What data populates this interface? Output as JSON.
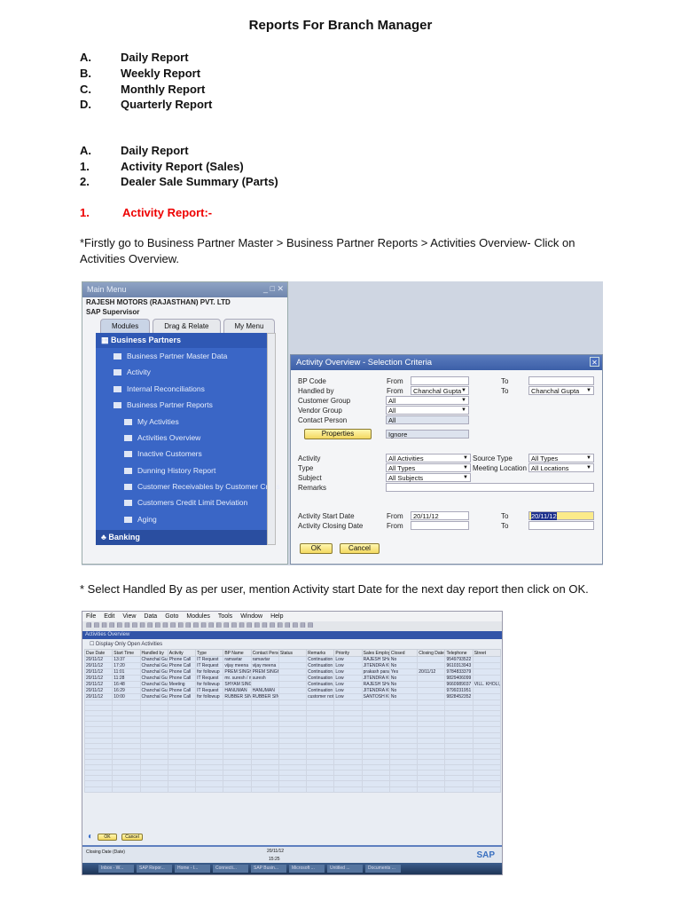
{
  "title": "Reports For Branch Manager",
  "overview": [
    {
      "letter": "A.",
      "label": "Daily Report"
    },
    {
      "letter": "B.",
      "label": "Weekly Report"
    },
    {
      "letter": "C.",
      "label": "Monthly Report"
    },
    {
      "letter": "D.",
      "label": "Quarterly Report"
    }
  ],
  "daily": {
    "letter": "A.",
    "label": "Daily Report",
    "items": [
      {
        "letter": "1.",
        "label": "Activity Report (Sales)"
      },
      {
        "letter": "2.",
        "label": "Dealer Sale Summary (Parts)"
      }
    ]
  },
  "section1": {
    "num": "1.",
    "title": "Activity Report:-"
  },
  "para1_line1": "*Firstly go to Business Partner Master > Business Partner Reports > Activities Overview- Click on",
  "para1_line2": "Activities Overview.",
  "para2": "* Select Handled By as per user, mention Activity start Date for the next day report then click on OK.",
  "main_menu": {
    "title": "Main Menu",
    "window_buttons": "_ □ ✕",
    "company": "RAJESH MOTORS (RAJASTHAN) PVT. LTD",
    "user": "SAP Supervisor",
    "tabs": [
      "Modules",
      "Drag & Relate",
      "My Menu"
    ],
    "module": "Business Partners",
    "items": [
      "Business Partner Master Data",
      "Activity",
      "Internal Reconciliations",
      "Business Partner Reports"
    ],
    "subitems": [
      "My Activities",
      "Activities Overview",
      "Inactive Customers",
      "Dunning History Report",
      "Customer Receivables by Customer Cross",
      "Customers Credit Limit Deviation",
      "Aging"
    ],
    "next_module": "Banking"
  },
  "dialog": {
    "title": "Activity Overview - Selection Criteria",
    "from": "From",
    "to": "To",
    "bp_code": "BP Code",
    "handled_by": "Handled by",
    "handled_from": "Chanchal Gupta",
    "handled_to": "Chanchal Gupta",
    "customer_group": "Customer Group",
    "customer_group_val": "All",
    "vendor_group": "Vendor Group",
    "vendor_group_val": "All",
    "contact_person": "Contact Person",
    "contact_person_val": "All",
    "properties": "Properties",
    "properties_val": "Ignore",
    "activity": "Activity",
    "activity_val": "All Activities",
    "source_type": "Source Type",
    "source_type_val": "All Types",
    "type": "Type",
    "type_val": "All Types",
    "meeting_location": "Meeting Location",
    "meeting_location_val": "All Locations",
    "subject": "Subject",
    "subject_val": "All Subjects",
    "remarks": "Remarks",
    "start_date": "Activity Start Date",
    "start_from": "20/11/12",
    "start_to": "20/11/12",
    "closing_date": "Activity Closing Date",
    "ok": "OK",
    "cancel": "Cancel"
  },
  "sap": {
    "menu": [
      "File",
      "Edit",
      "View",
      "Data",
      "Goto",
      "Modules",
      "Tools",
      "Window",
      "Help"
    ],
    "window_title": "Activities Overview",
    "checkbox": "Display Only Open Activities",
    "columns": [
      "Due Date",
      "Start Time",
      "Handled by",
      "Activity",
      "Type",
      "BP Name",
      "Contact Person",
      "Status",
      "Remarks",
      "Priority",
      "Sales Employee",
      "Closed",
      "Closing Date",
      "Telephone",
      "Street"
    ],
    "rows": [
      [
        "20/11/12",
        "13:37",
        "Chanchal Gupta",
        "Phone Call",
        "IT Request",
        "ramavtar",
        "ramavtar",
        "",
        "Continuation",
        "Low",
        "RAJESH SHARMA",
        "No",
        "",
        "9549793522",
        ""
      ],
      [
        "20/11/12",
        "17:20",
        "Chanchal Gupta",
        "Phone Call",
        "IT Request",
        "vijay meena",
        "vijay meena",
        "",
        "Continuation",
        "Low",
        "JITENDRA KUMAR GUPTA",
        "No",
        "",
        "9610313943",
        ""
      ],
      [
        "20/11/12",
        "11:01",
        "Chanchal Gupta",
        "Phone Call",
        "for followup",
        "PREM SINGH",
        "PREM SINGH",
        "",
        "Continuation, purchased",
        "Low",
        "prakash parashar",
        "Yes",
        "20/11/12",
        "9784833379",
        ""
      ],
      [
        "20/11/12",
        "11:28",
        "Chanchal Gupta",
        "Phone Call",
        "IT Request",
        "mr. suresh / mr. jitendra",
        "suresh",
        "",
        "Continuation",
        "Low",
        "JITENDRA KUMAR GUPTA",
        "No",
        "",
        "9829406099",
        ""
      ],
      [
        "20/11/12",
        "16:48",
        "Chanchal Gupta",
        "Meeting",
        "for followup",
        "SHYAM SINGH",
        "",
        "",
        "Continuation, # # NEC",
        "Low",
        "RAJESH SHARMA",
        "No",
        "",
        "9660989037",
        "VILL. KHOLI, KHATIPURA, TEHSIL - BAS"
      ],
      [
        "20/11/12",
        "16:29",
        "Chanchal Gupta",
        "Phone Call",
        "IT Request",
        "HANUMAN",
        "HANUMAN",
        "",
        "Continuation",
        "Low",
        "JITENDRA KUMAR GUPTA",
        "No",
        "",
        "9799231951",
        ""
      ],
      [
        "20/11/12",
        "10:00",
        "Chanchal Gupta",
        "Phone Call",
        "for followup",
        "RUBBER SINGH",
        "RUBBER SINGH",
        "",
        "customer not purchased",
        "Low",
        "SANTOSH KHANDELWAL",
        "No",
        "",
        "9828452352",
        ""
      ]
    ],
    "ok": "OK",
    "cancel": "Cancel",
    "status_label": "Closing Date (Date)",
    "status_date": "20/11/12",
    "status_time": "15:25",
    "logo": "SAP",
    "taskbar": [
      "Inbox - W...",
      "SAP Repor...",
      "Home - I...",
      "Connecti...",
      "SAP Busin...",
      "Microsoft ...",
      "Untitled ...",
      "Documents ..."
    ]
  }
}
